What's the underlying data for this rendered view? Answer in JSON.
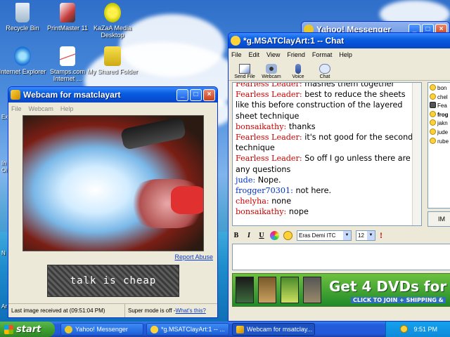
{
  "desktop": {
    "icons": [
      {
        "label": "Recycle Bin",
        "icon": "recycle-bin-icon"
      },
      {
        "label": "PrintMaster 11",
        "icon": "printmaster-icon"
      },
      {
        "label": "KaZaA Media Desktop",
        "icon": "kazaa-icon"
      },
      {
        "label": "Internet Explorer",
        "icon": "ie-icon"
      },
      {
        "label": "Stamps.com Internet ...",
        "icon": "stamps-icon"
      },
      {
        "label": "My Shared Folder",
        "icon": "shared-folder-icon"
      }
    ],
    "edge_labels": [
      "Ex",
      "In",
      "Oi",
      "N",
      "Ar"
    ]
  },
  "yahoo_window": {
    "title": "Yahoo! Messenger"
  },
  "chat_window": {
    "title": "*g.MSATClayArt:1 -- Chat",
    "menu": [
      "File",
      "Edit",
      "View",
      "Friend",
      "Format",
      "Help"
    ],
    "toolbar": [
      "Send File",
      "Webcam",
      "Voice",
      "Chat"
    ],
    "messages": [
      {
        "name": "Fearless Leader:",
        "text": "mashes them together",
        "color": "#cc0000"
      },
      {
        "name": "Fearless Leader:",
        "text": "best to reduce the sheets like this before construction of the layered sheet technique",
        "color": "#cc0000"
      },
      {
        "name": "bonsaikathy:",
        "text": "thanks",
        "color": "#cc0000"
      },
      {
        "name": "Fearless Leader:",
        "text": "it's not good for the second technique",
        "color": "#cc0000"
      },
      {
        "name": "Fearless Leader:",
        "text": "So off I go unless there are any questions",
        "color": "#cc0000"
      },
      {
        "name": "jude:",
        "text": "Nope.",
        "color": "#0033cc"
      },
      {
        "name": "frogger70301:",
        "text": "not here.",
        "color": "#0033cc"
      },
      {
        "name": "chelyha:",
        "text": "none",
        "color": "#cc0000"
      },
      {
        "name": "bonsaikathy:",
        "text": "nope",
        "color": "#cc0000"
      }
    ],
    "users": [
      "bon",
      "chel",
      "Fea",
      "frog",
      "jakn",
      "jude",
      "rube"
    ],
    "im_label": "IM",
    "format": {
      "bold": "B",
      "italic": "I",
      "underline": "U",
      "font": "Eras Demi ITC",
      "size": "12"
    },
    "ad": {
      "headline": "Get 4 DVDs for 49¢",
      "cta": "CLICK TO JOIN",
      "shipping": "+ SHIPPING &"
    }
  },
  "webcam_window": {
    "title": "Webcam for msatclayart",
    "menu": [
      "File",
      "Webcam",
      "Help"
    ],
    "report_link": "Report Abuse",
    "captcha": "talk is cheap",
    "status_left": "Last image received at (09:51:04 PM)",
    "status_right_text": "Super mode is off - ",
    "status_right_link": "What's this?"
  },
  "taskbar": {
    "start": "start",
    "tasks": [
      "Yahoo! Messenger",
      "*g.MSATClayArt:1 -- ...",
      "Webcam for msatclay..."
    ],
    "clock": "9:51 PM"
  }
}
